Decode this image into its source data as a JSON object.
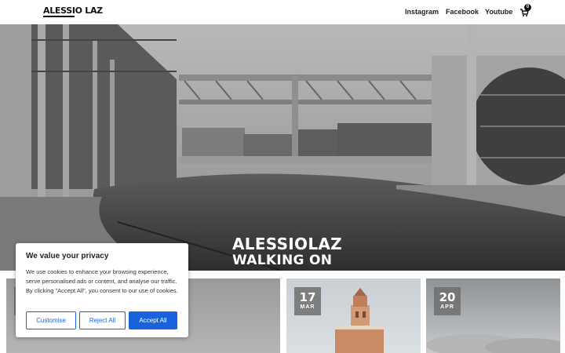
{
  "header": {
    "logo": "ALESSIO LAZ",
    "nav": [
      {
        "label": "Instagram"
      },
      {
        "label": "Facebook"
      },
      {
        "label": "Youtube"
      }
    ],
    "cart_count": "0"
  },
  "hero": {
    "title": "ALESSIOLAZ",
    "subtitle": "WALKING ON"
  },
  "cards": [
    {
      "day": "",
      "month": ""
    },
    {
      "day": "17",
      "month": "MAR"
    },
    {
      "day": "20",
      "month": "APR"
    }
  ],
  "cookie": {
    "title": "We value your privacy",
    "text": "We use cookies to enhance your browsing experience, serve personalised ads or content, and analyse our traffic. By clicking \"Accept All\", you consent to our use of cookies.",
    "customise": "Customise",
    "reject": "Reject All",
    "accept": "Accept All"
  },
  "colors": {
    "accent": "#1863dc",
    "header_bg": "#ffffff",
    "text": "#111111"
  }
}
